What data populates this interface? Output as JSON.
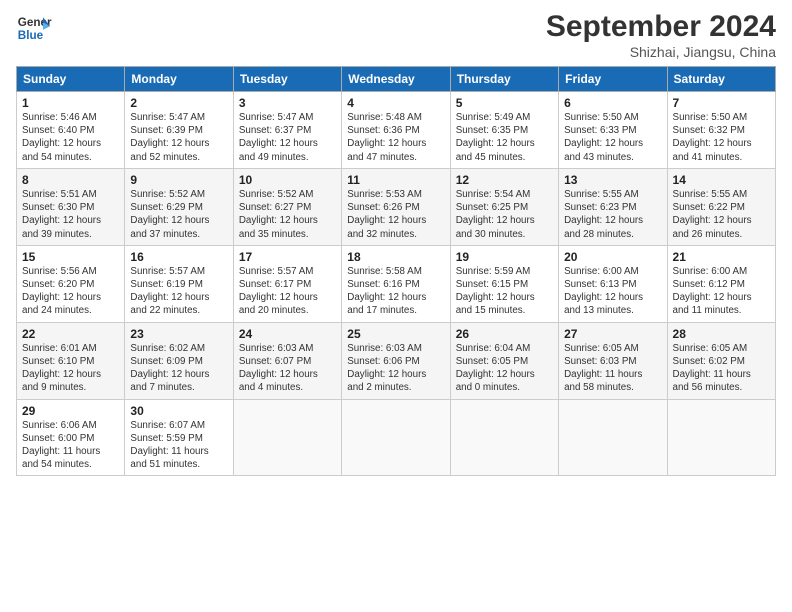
{
  "header": {
    "logo_text_1": "General",
    "logo_text_2": "Blue",
    "main_title": "September 2024",
    "sub_title": "Shizhai, Jiangsu, China"
  },
  "weekdays": [
    "Sunday",
    "Monday",
    "Tuesday",
    "Wednesday",
    "Thursday",
    "Friday",
    "Saturday"
  ],
  "weeks": [
    [
      {
        "day": "1",
        "info": "Sunrise: 5:46 AM\nSunset: 6:40 PM\nDaylight: 12 hours\nand 54 minutes."
      },
      {
        "day": "2",
        "info": "Sunrise: 5:47 AM\nSunset: 6:39 PM\nDaylight: 12 hours\nand 52 minutes."
      },
      {
        "day": "3",
        "info": "Sunrise: 5:47 AM\nSunset: 6:37 PM\nDaylight: 12 hours\nand 49 minutes."
      },
      {
        "day": "4",
        "info": "Sunrise: 5:48 AM\nSunset: 6:36 PM\nDaylight: 12 hours\nand 47 minutes."
      },
      {
        "day": "5",
        "info": "Sunrise: 5:49 AM\nSunset: 6:35 PM\nDaylight: 12 hours\nand 45 minutes."
      },
      {
        "day": "6",
        "info": "Sunrise: 5:50 AM\nSunset: 6:33 PM\nDaylight: 12 hours\nand 43 minutes."
      },
      {
        "day": "7",
        "info": "Sunrise: 5:50 AM\nSunset: 6:32 PM\nDaylight: 12 hours\nand 41 minutes."
      }
    ],
    [
      {
        "day": "8",
        "info": "Sunrise: 5:51 AM\nSunset: 6:30 PM\nDaylight: 12 hours\nand 39 minutes."
      },
      {
        "day": "9",
        "info": "Sunrise: 5:52 AM\nSunset: 6:29 PM\nDaylight: 12 hours\nand 37 minutes."
      },
      {
        "day": "10",
        "info": "Sunrise: 5:52 AM\nSunset: 6:27 PM\nDaylight: 12 hours\nand 35 minutes."
      },
      {
        "day": "11",
        "info": "Sunrise: 5:53 AM\nSunset: 6:26 PM\nDaylight: 12 hours\nand 32 minutes."
      },
      {
        "day": "12",
        "info": "Sunrise: 5:54 AM\nSunset: 6:25 PM\nDaylight: 12 hours\nand 30 minutes."
      },
      {
        "day": "13",
        "info": "Sunrise: 5:55 AM\nSunset: 6:23 PM\nDaylight: 12 hours\nand 28 minutes."
      },
      {
        "day": "14",
        "info": "Sunrise: 5:55 AM\nSunset: 6:22 PM\nDaylight: 12 hours\nand 26 minutes."
      }
    ],
    [
      {
        "day": "15",
        "info": "Sunrise: 5:56 AM\nSunset: 6:20 PM\nDaylight: 12 hours\nand 24 minutes."
      },
      {
        "day": "16",
        "info": "Sunrise: 5:57 AM\nSunset: 6:19 PM\nDaylight: 12 hours\nand 22 minutes."
      },
      {
        "day": "17",
        "info": "Sunrise: 5:57 AM\nSunset: 6:17 PM\nDaylight: 12 hours\nand 20 minutes."
      },
      {
        "day": "18",
        "info": "Sunrise: 5:58 AM\nSunset: 6:16 PM\nDaylight: 12 hours\nand 17 minutes."
      },
      {
        "day": "19",
        "info": "Sunrise: 5:59 AM\nSunset: 6:15 PM\nDaylight: 12 hours\nand 15 minutes."
      },
      {
        "day": "20",
        "info": "Sunrise: 6:00 AM\nSunset: 6:13 PM\nDaylight: 12 hours\nand 13 minutes."
      },
      {
        "day": "21",
        "info": "Sunrise: 6:00 AM\nSunset: 6:12 PM\nDaylight: 12 hours\nand 11 minutes."
      }
    ],
    [
      {
        "day": "22",
        "info": "Sunrise: 6:01 AM\nSunset: 6:10 PM\nDaylight: 12 hours\nand 9 minutes."
      },
      {
        "day": "23",
        "info": "Sunrise: 6:02 AM\nSunset: 6:09 PM\nDaylight: 12 hours\nand 7 minutes."
      },
      {
        "day": "24",
        "info": "Sunrise: 6:03 AM\nSunset: 6:07 PM\nDaylight: 12 hours\nand 4 minutes."
      },
      {
        "day": "25",
        "info": "Sunrise: 6:03 AM\nSunset: 6:06 PM\nDaylight: 12 hours\nand 2 minutes."
      },
      {
        "day": "26",
        "info": "Sunrise: 6:04 AM\nSunset: 6:05 PM\nDaylight: 12 hours\nand 0 minutes."
      },
      {
        "day": "27",
        "info": "Sunrise: 6:05 AM\nSunset: 6:03 PM\nDaylight: 11 hours\nand 58 minutes."
      },
      {
        "day": "28",
        "info": "Sunrise: 6:05 AM\nSunset: 6:02 PM\nDaylight: 11 hours\nand 56 minutes."
      }
    ],
    [
      {
        "day": "29",
        "info": "Sunrise: 6:06 AM\nSunset: 6:00 PM\nDaylight: 11 hours\nand 54 minutes."
      },
      {
        "day": "30",
        "info": "Sunrise: 6:07 AM\nSunset: 5:59 PM\nDaylight: 11 hours\nand 51 minutes."
      },
      null,
      null,
      null,
      null,
      null
    ]
  ]
}
